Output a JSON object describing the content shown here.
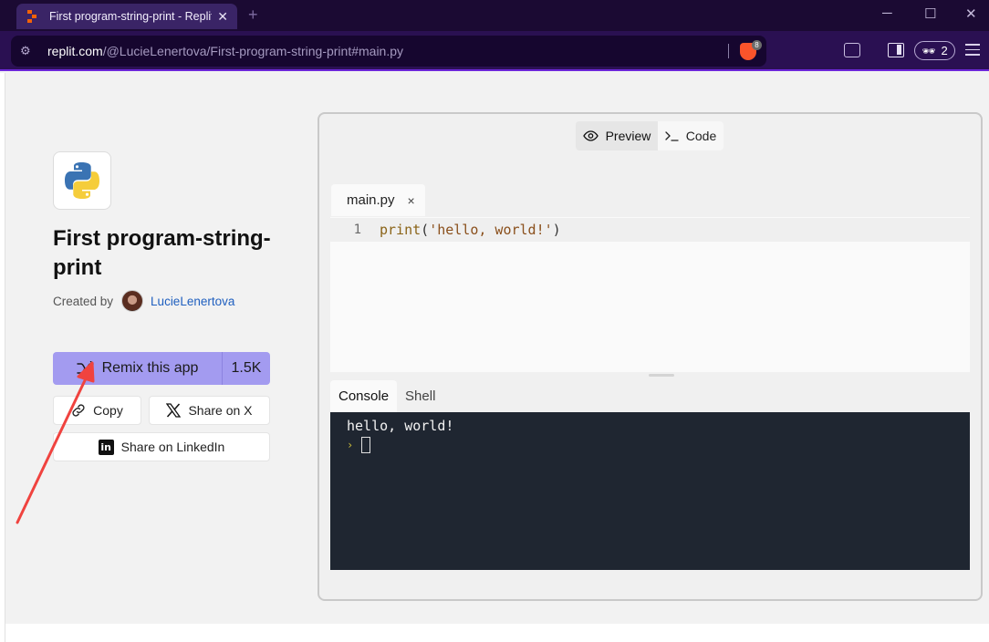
{
  "browser": {
    "tab_title": "First program-string-print - Replit",
    "tab_close": "✕",
    "new_tab": "+",
    "window_min": "─",
    "window_max": "☐",
    "window_close": "✕",
    "url_host": "replit.com",
    "url_path": "/@LucieLenertova/First-program-string-print#main.py",
    "brave_badge": "8",
    "profile_count": "2",
    "profile_icon": "🕶"
  },
  "app": {
    "title": "First program-string-print",
    "created_by_label": "Created by",
    "author": "LucieLenertova",
    "remix_label": "Remix this app",
    "remix_count": "1.5K",
    "copy_label": "Copy",
    "share_x_label": "Share on X",
    "share_linkedin_label": "Share on LinkedIn"
  },
  "repl": {
    "preview_label": "Preview",
    "code_label": "Code",
    "file_tab": "main.py",
    "file_tab_close": "×",
    "line_number": "1",
    "code_fn": "print",
    "code_open": "(",
    "code_string": "'hello, world!'",
    "code_close": ")",
    "console_tab": "Console",
    "shell_tab": "Shell",
    "console_output": "hello, world!",
    "prompt": "›"
  },
  "colors": {
    "accent_purple": "#a39bf0",
    "browser_bar": "#2a1052",
    "console_bg": "#1f2631",
    "annotation_arrow": "#f0433f"
  }
}
